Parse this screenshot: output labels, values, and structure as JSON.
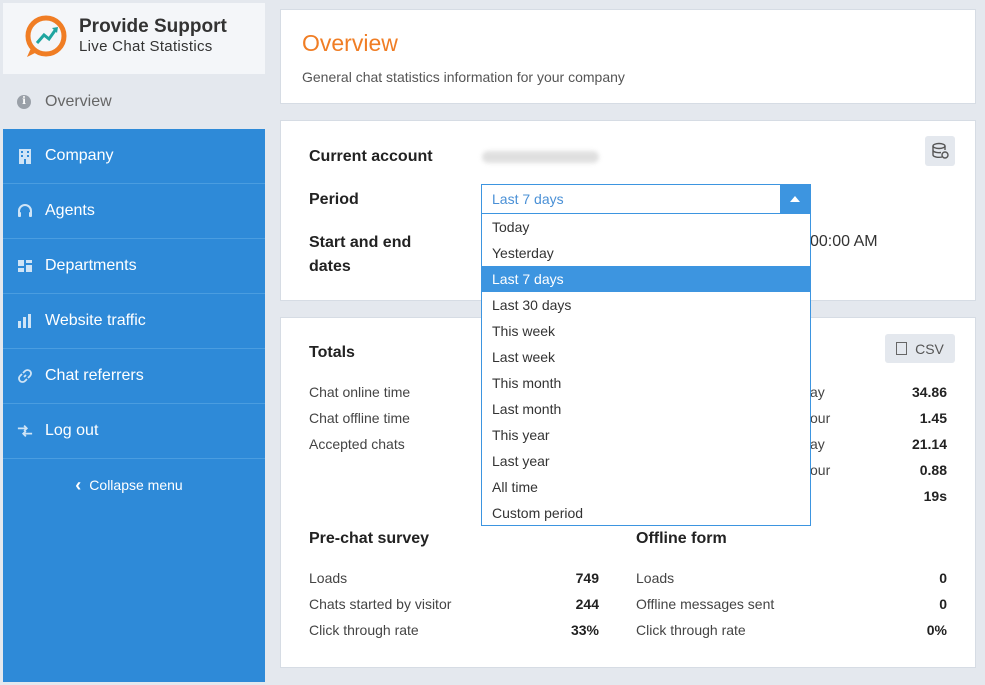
{
  "brand": {
    "title": "Provide Support",
    "subtitle": "Live Chat Statistics",
    "accent": "#f07d24",
    "secondary": "#1fa5a0"
  },
  "sidebar": {
    "overview": {
      "label": "Overview",
      "icon": "info-icon"
    },
    "items": [
      {
        "label": "Company",
        "icon": "building-icon"
      },
      {
        "label": "Agents",
        "icon": "headset-icon"
      },
      {
        "label": "Departments",
        "icon": "departments-icon"
      },
      {
        "label": "Website traffic",
        "icon": "bar-chart-icon"
      },
      {
        "label": "Chat referrers",
        "icon": "link-icon"
      },
      {
        "label": "Log out",
        "icon": "logout-icon"
      }
    ],
    "collapse_label": "Collapse menu"
  },
  "overview": {
    "title": "Overview",
    "subtitle": "General chat statistics information for your company"
  },
  "filters": {
    "current_account_label": "Current account",
    "period_label": "Period",
    "period_value": "Last 7 days",
    "dates_label_line1": "Start and end",
    "dates_label_line2": "dates",
    "dates_fragment": "00:00 AM",
    "options": [
      "Today",
      "Yesterday",
      "Last 7 days",
      "Last 30 days",
      "This week",
      "Last week",
      "This month",
      "Last month",
      "This year",
      "Last year",
      "All time",
      "Custom period"
    ]
  },
  "totals": {
    "title": "Totals",
    "csv_label": "CSV",
    "left_rows": [
      "Chat online time",
      "Chat offline time",
      "Accepted chats"
    ],
    "right_fragments": [
      "ay",
      "our",
      "ay",
      "our",
      ""
    ],
    "right_values": [
      "34.86",
      "1.45",
      "21.14",
      "0.88",
      "19s"
    ]
  },
  "prechat": {
    "title": "Pre-chat survey",
    "rows": [
      {
        "label": "Loads",
        "value": "749"
      },
      {
        "label": "Chats started by visitor",
        "value": "244"
      },
      {
        "label": "Click through rate",
        "value": "33%"
      }
    ]
  },
  "offline": {
    "title": "Offline form",
    "rows": [
      {
        "label": "Loads",
        "value": "0"
      },
      {
        "label": "Offline messages sent",
        "value": "0"
      },
      {
        "label": "Click through rate",
        "value": "0%"
      }
    ]
  }
}
